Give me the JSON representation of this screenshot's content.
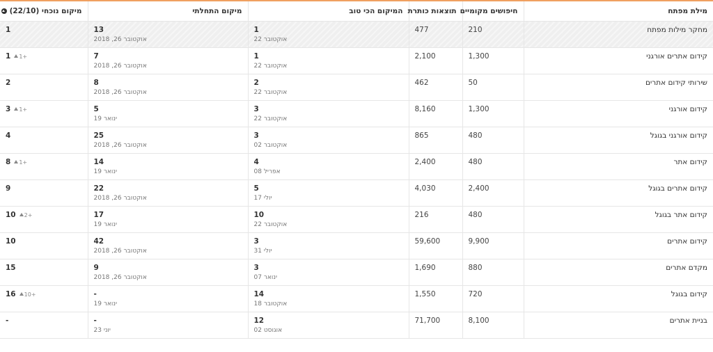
{
  "headers": {
    "keyword": "מילת מפתח",
    "local_searches": "חיפושים מקומיים",
    "competing_results": "תוצאות כותרת",
    "best_position": "המיקום הכי טוב",
    "initial_position": "מיקום התחלתי",
    "current_position": "מיקום נוכחי (22/10)"
  },
  "rows": [
    {
      "keyword": "מחקר מילות מפתח",
      "searches": "210",
      "results": "477",
      "best": "1",
      "best_date": "אוקטובר 22",
      "initial": "13",
      "initial_date": "אוקטובר 26, 2018",
      "current": "1",
      "delta": ""
    },
    {
      "keyword": "קידום אתרים אורגני",
      "searches": "1,300",
      "results": "2,100",
      "best": "1",
      "best_date": "אוקטובר 22",
      "initial": "7",
      "initial_date": "אוקטובר 26, 2018",
      "current": "1",
      "delta": "+1"
    },
    {
      "keyword": "שירותי קידום אתרים",
      "searches": "50",
      "results": "462",
      "best": "2",
      "best_date": "אוקטובר 22",
      "initial": "8",
      "initial_date": "אוקטובר 26, 2018",
      "current": "2",
      "delta": ""
    },
    {
      "keyword": "קידום אורגני",
      "searches": "1,300",
      "results": "8,160",
      "best": "3",
      "best_date": "אוקטובר 22",
      "initial": "5",
      "initial_date": "ינואר 19",
      "current": "3",
      "delta": "+1"
    },
    {
      "keyword": "קידום אורגני בגוגל",
      "searches": "480",
      "results": "865",
      "best": "3",
      "best_date": "אוקטובר 02",
      "initial": "25",
      "initial_date": "אוקטובר 26, 2018",
      "current": "4",
      "delta": ""
    },
    {
      "keyword": "קידום אתר",
      "searches": "480",
      "results": "2,400",
      "best": "4",
      "best_date": "אפריל 08",
      "initial": "14",
      "initial_date": "ינואר 19",
      "current": "8",
      "delta": "+1"
    },
    {
      "keyword": "קידום אתרים בגוגל",
      "searches": "2,400",
      "results": "4,030",
      "best": "5",
      "best_date": "יולי 17",
      "initial": "22",
      "initial_date": "אוקטובר 26, 2018",
      "current": "9",
      "delta": ""
    },
    {
      "keyword": "קידום אתר בגוגל",
      "searches": "480",
      "results": "216",
      "best": "10",
      "best_date": "אוקטובר 22",
      "initial": "17",
      "initial_date": "ינואר 19",
      "current": "10",
      "delta": "+2"
    },
    {
      "keyword": "קידום אתרים",
      "searches": "9,900",
      "results": "59,600",
      "best": "3",
      "best_date": "יולי 31",
      "initial": "42",
      "initial_date": "אוקטובר 26, 2018",
      "current": "10",
      "delta": ""
    },
    {
      "keyword": "מקדם אתרים",
      "searches": "880",
      "results": "1,690",
      "best": "3",
      "best_date": "ינואר 07",
      "initial": "9",
      "initial_date": "אוקטובר 26, 2018",
      "current": "15",
      "delta": ""
    },
    {
      "keyword": "קידום בגוגל",
      "searches": "720",
      "results": "1,550",
      "best": "14",
      "best_date": "אוקטובר 18",
      "initial": "-",
      "initial_date": "ינואר 19",
      "current": "16",
      "delta": "+10"
    },
    {
      "keyword": "בניית אתרים",
      "searches": "8,100",
      "results": "71,700",
      "best": "12",
      "best_date": "אוגוסט 02",
      "initial": "-",
      "initial_date": "יוני 23",
      "current": "-",
      "delta": ""
    }
  ]
}
